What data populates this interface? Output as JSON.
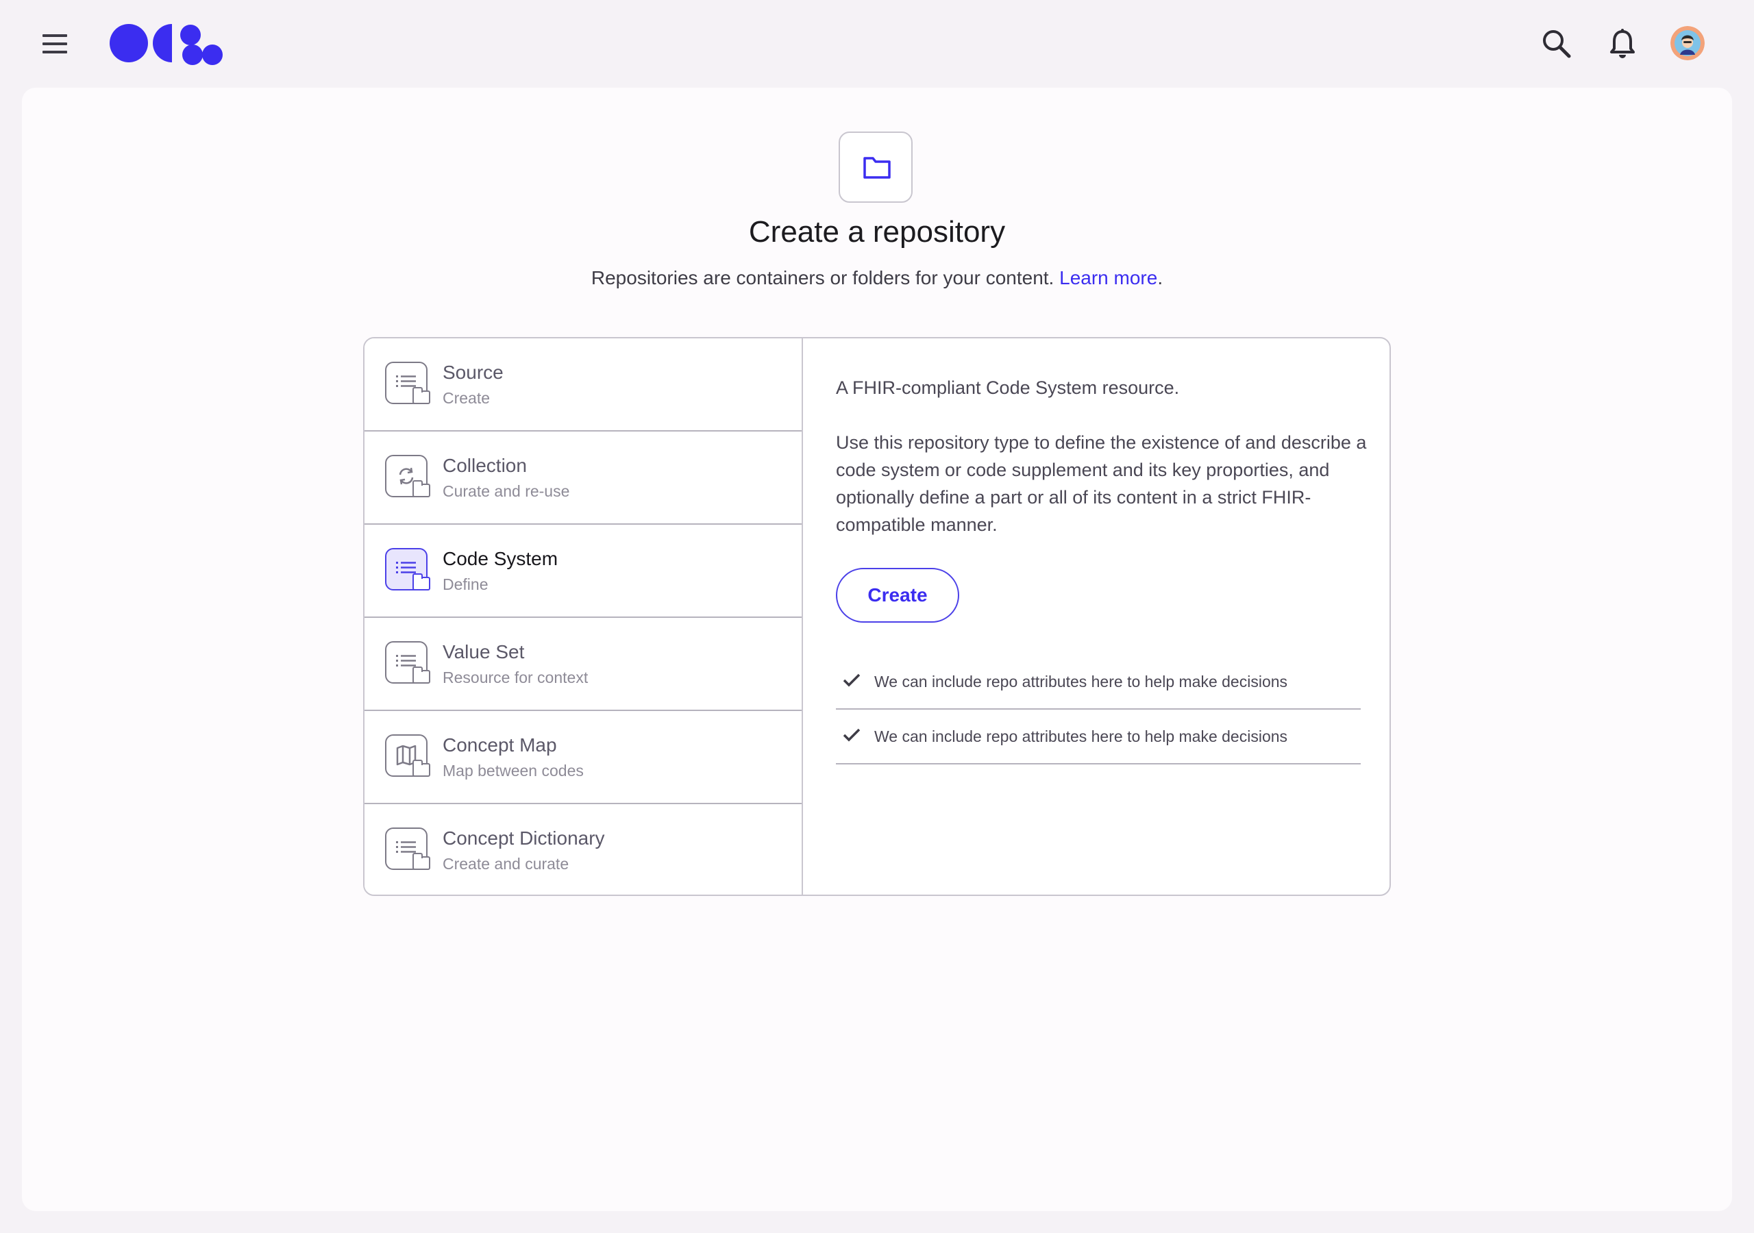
{
  "header": {
    "menu_icon": "hamburger-menu-icon",
    "logo": "ocl-logo",
    "search_icon": "search-icon",
    "notifications_icon": "bell-icon",
    "avatar": "user-avatar"
  },
  "page": {
    "hero_icon": "folder-icon",
    "title": "Create a repository",
    "subtitle": "Repositories are containers or folders for your content.",
    "learn_more": "Learn more",
    "subtitle_end": "."
  },
  "repo_types": [
    {
      "name": "Source",
      "description": "Create",
      "icon": "list-icon"
    },
    {
      "name": "Collection",
      "description": "Curate and re-use",
      "icon": "refresh-icon"
    },
    {
      "name": "Code System",
      "description": "Define",
      "icon": "list-icon"
    },
    {
      "name": "Value Set",
      "description": "Resource for context",
      "icon": "list-icon"
    },
    {
      "name": "Concept Map",
      "description": "Map between codes",
      "icon": "map-icon"
    },
    {
      "name": "Concept Dictionary",
      "description": "Create and curate",
      "icon": "list-icon"
    }
  ],
  "selected_type": "Code System",
  "detail": {
    "summary": "A FHIR-compliant Code System resource.",
    "body": "Use this repository type to define the existence of and describe a code system or code supplement and its key proporties, and optionally define a part or all of its content in a strict FHIR-compatible manner.",
    "create_label": "Create",
    "features": [
      "We can include repo attributes here to help make decisions",
      "We can include repo attributes here to help make decisions"
    ]
  },
  "colors": {
    "accent": "#3b2df0",
    "background": "#f5f2f6",
    "card": "#fdfbfd",
    "border": "#c9c6cf"
  }
}
